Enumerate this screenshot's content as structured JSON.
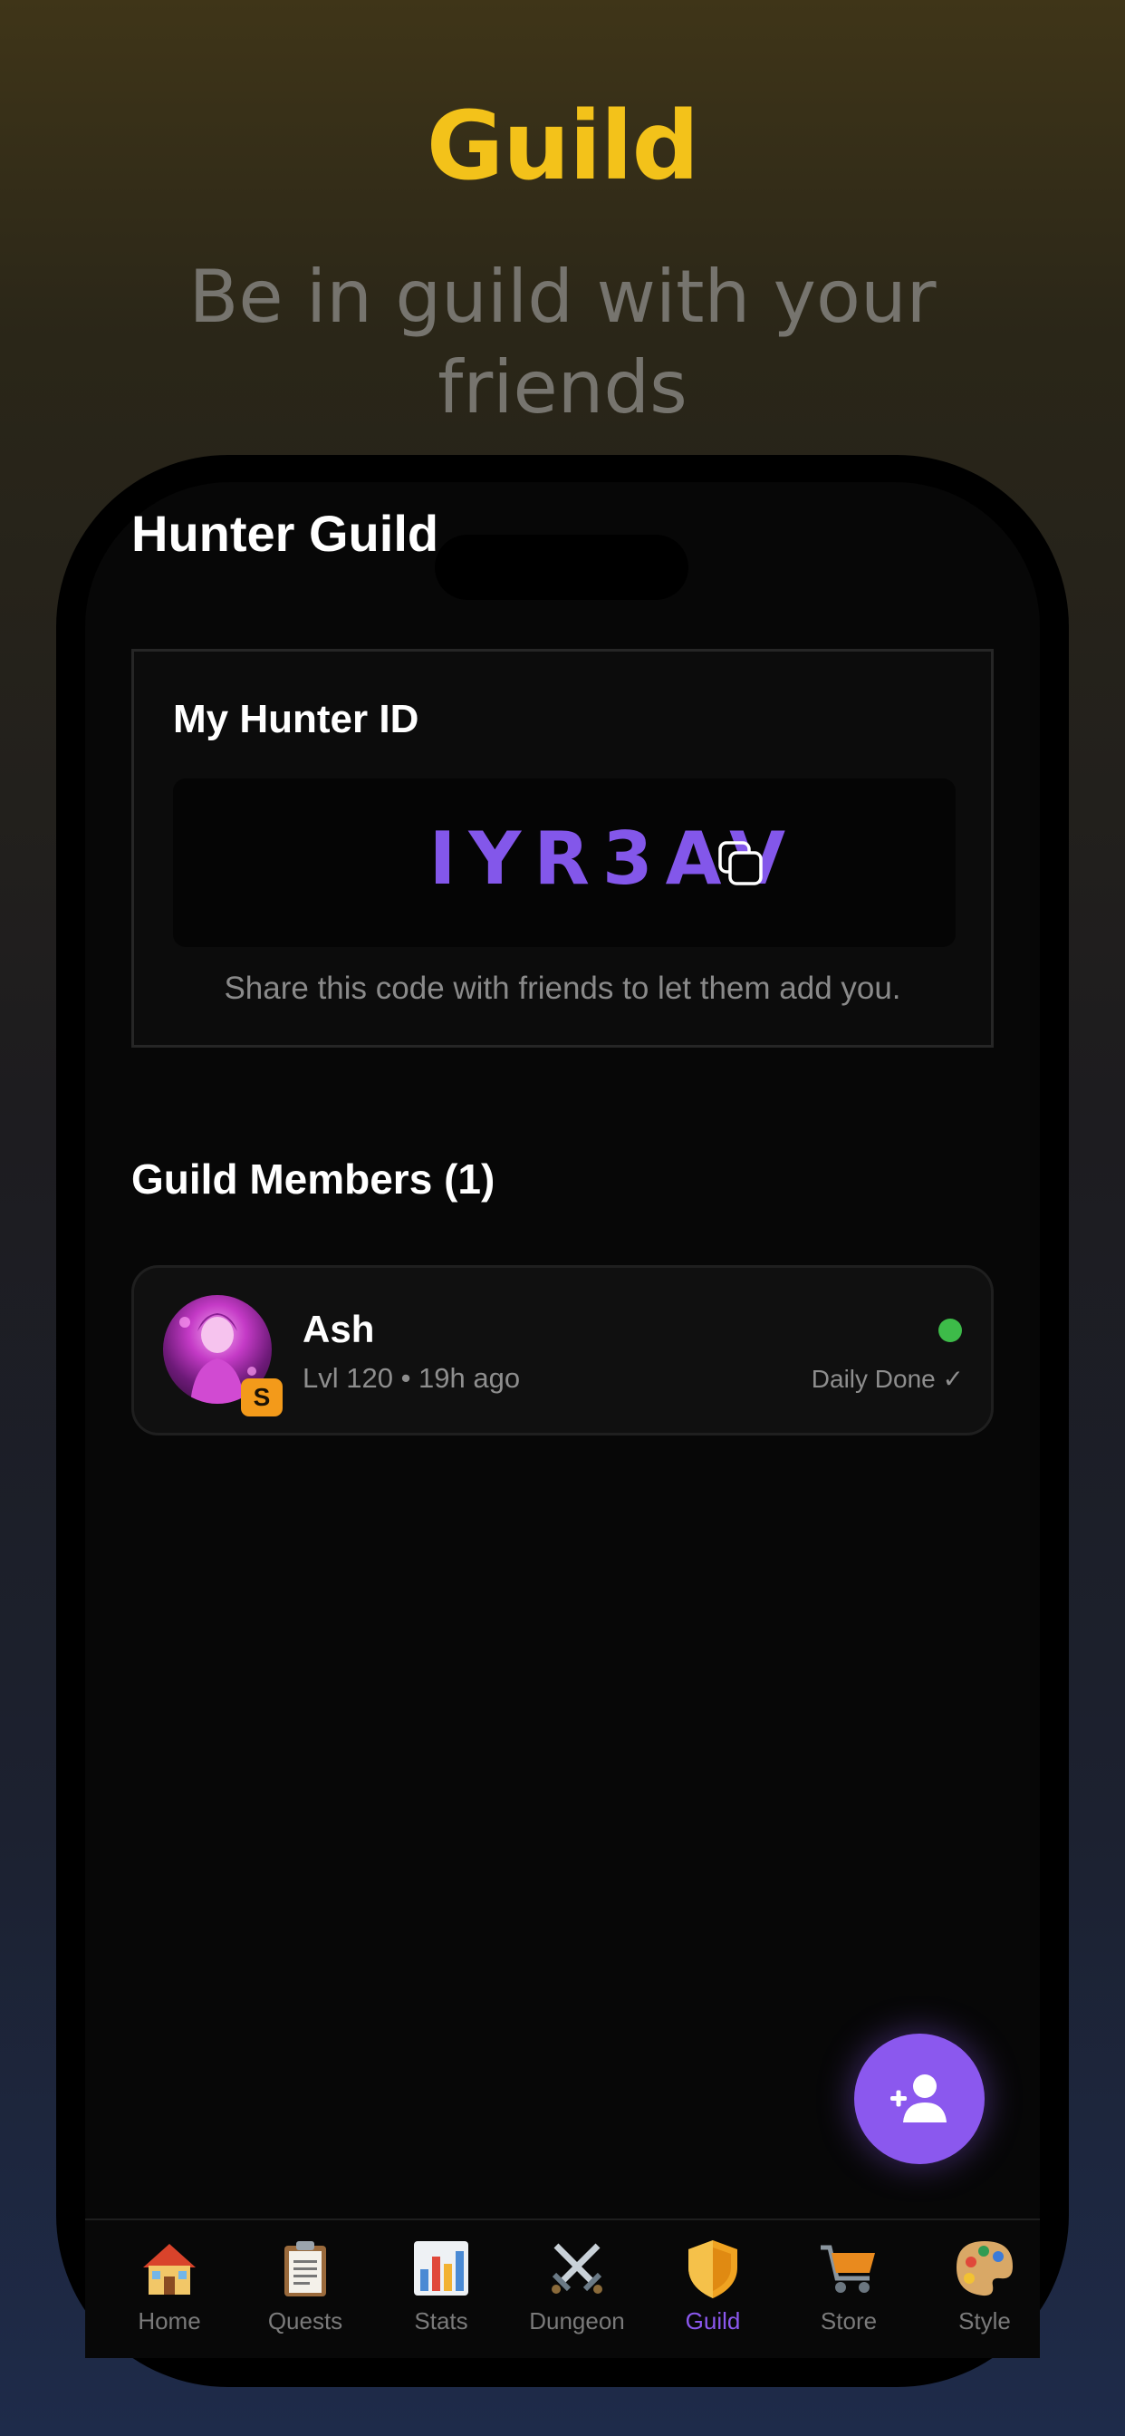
{
  "promo": {
    "title": "Guild",
    "subtitle": "Be in guild with your friends"
  },
  "screen": {
    "title": "Hunter Guild",
    "hunter_id_card": {
      "title": "My Hunter ID",
      "code": "IYR3AV",
      "copy_icon": "copy-icon",
      "hint": "Share this code with friends to let them add you."
    },
    "members": {
      "title": "Guild Members (1)",
      "list": [
        {
          "name": "Ash",
          "meta": "Lvl 120 • 19h ago",
          "rank": "S",
          "status": "Daily Done ✓",
          "online": true
        }
      ]
    },
    "fab_icon": "add-user-icon"
  },
  "tabs": [
    {
      "label": "Home",
      "icon": "house-icon",
      "active": false
    },
    {
      "label": "Quests",
      "icon": "clipboard-icon",
      "active": false
    },
    {
      "label": "Stats",
      "icon": "bar-chart-icon",
      "active": false
    },
    {
      "label": "Dungeon",
      "icon": "crossed-swords-icon",
      "active": false
    },
    {
      "label": "Guild",
      "icon": "shield-icon",
      "active": true
    },
    {
      "label": "Store",
      "icon": "shopping-cart-icon",
      "active": false
    },
    {
      "label": "Style",
      "icon": "palette-icon",
      "active": false
    }
  ],
  "colors": {
    "accent": "#8b58ee",
    "promo_title": "#f3c21a",
    "rank_badge": "#f39a1a",
    "online": "#3dbb49"
  }
}
